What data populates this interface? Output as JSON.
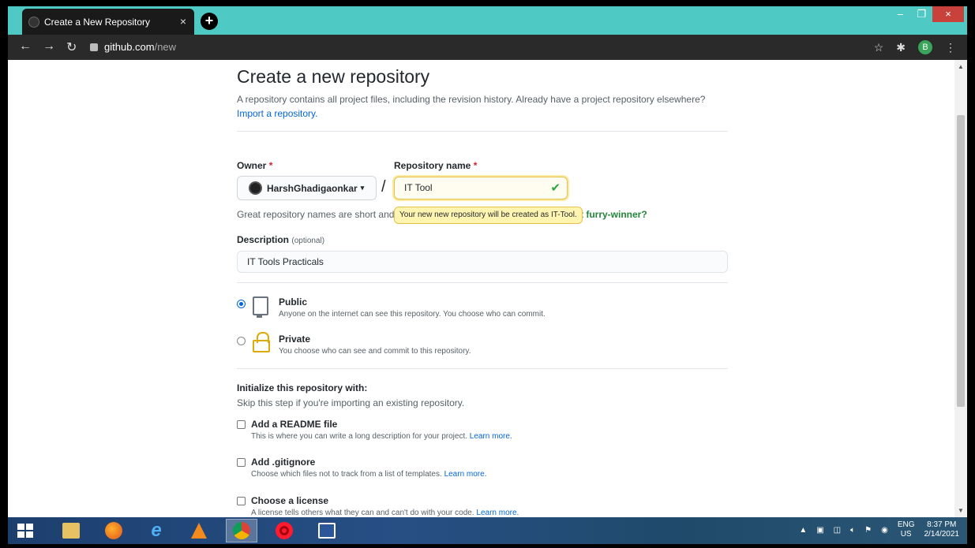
{
  "browser": {
    "tab_title": "Create a New Repository",
    "tab_close": "×",
    "new_tab": "+",
    "url_host": "github.com",
    "url_path": "/new",
    "profile_initial": "B",
    "window_min": "–",
    "window_restore": "❐",
    "window_close": "×"
  },
  "page": {
    "title": "Create a new repository",
    "subtitle": "A repository contains all project files, including the revision history. Already have a project repository elsewhere?",
    "import_link": "Import a repository.",
    "owner_label": "Owner",
    "required_mark": "*",
    "owner_value": "HarshGhadigaonkar",
    "separator": "/",
    "repo_name_label": "Repository name",
    "repo_name_value": "IT Tool",
    "tooltip": "Your new new repository will be created as IT-Tool.",
    "great_names": "Great repository names are short and",
    "great_names_tail": "t furry-winner?",
    "description_label": "Description",
    "description_optional": "(optional)",
    "description_value": "IT Tools Practicals",
    "visibility": [
      {
        "title": "Public",
        "desc": "Anyone on the internet can see this repository. You choose who can commit.",
        "selected": true
      },
      {
        "title": "Private",
        "desc": "You choose who can see and commit to this repository.",
        "selected": false
      }
    ],
    "init_title": "Initialize this repository with:",
    "init_sub": "Skip this step if you're importing an existing repository.",
    "init_options": [
      {
        "title": "Add a README file",
        "desc": "This is where you can write a long description for your project.",
        "link": "Learn more."
      },
      {
        "title": "Add .gitignore",
        "desc": "Choose which files not to track from a list of templates.",
        "link": "Learn more."
      },
      {
        "title": "Choose a license",
        "desc": "A license tells others what they can and can't do with your code.",
        "link": "Learn more."
      }
    ]
  },
  "taskbar": {
    "lang_top": "ENG",
    "lang_bottom": "US",
    "time": "8:37 PM",
    "date": "2/14/2021"
  }
}
